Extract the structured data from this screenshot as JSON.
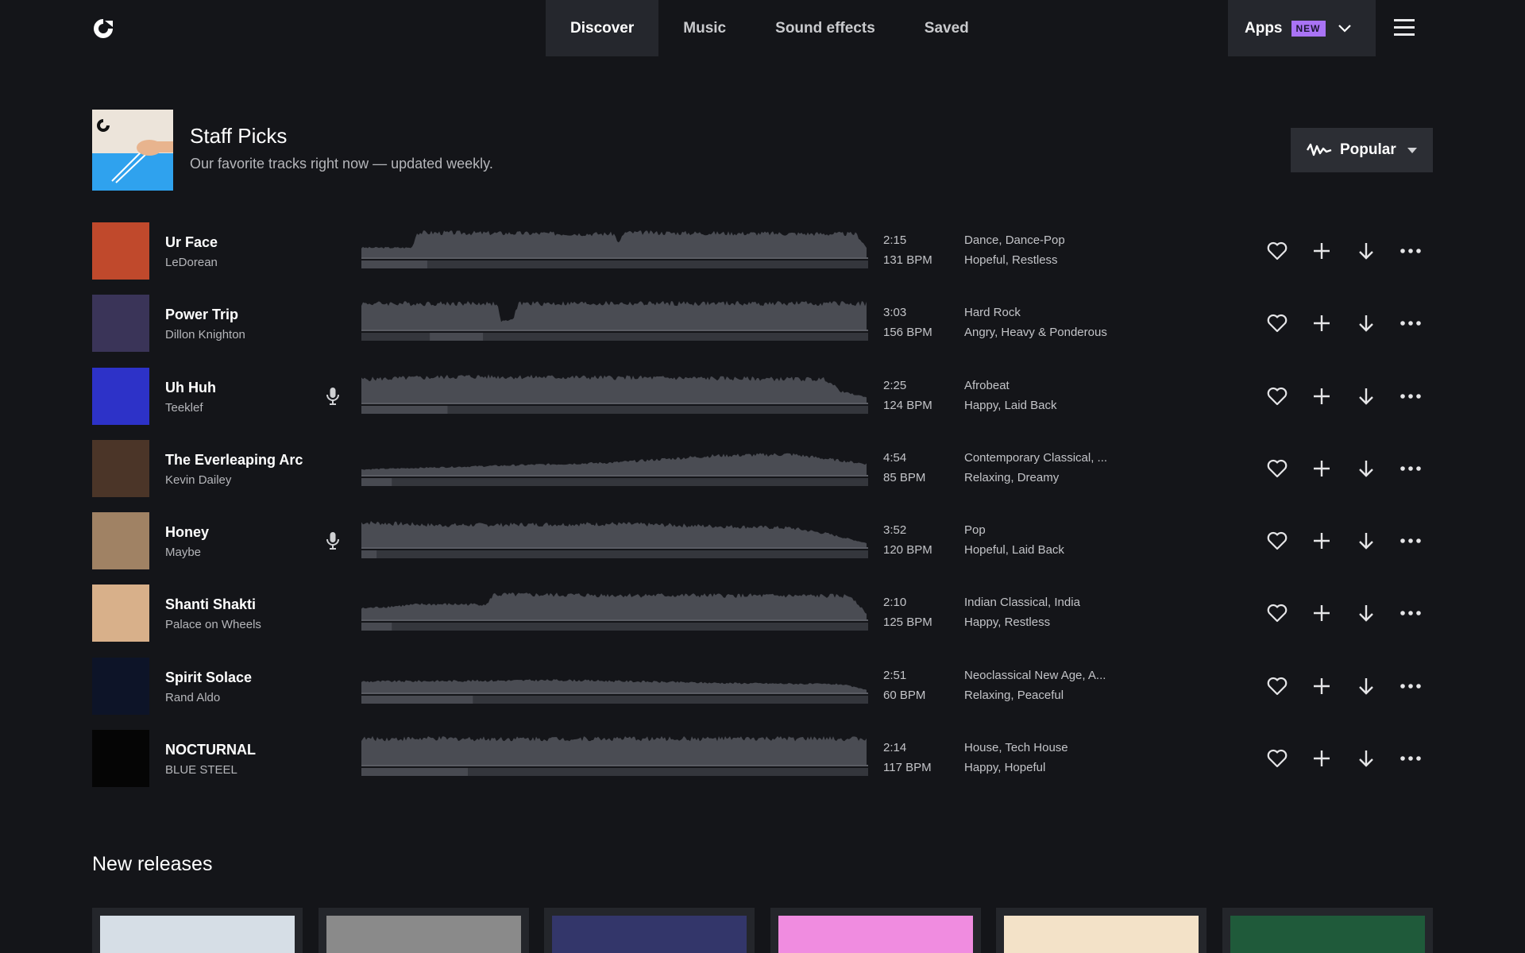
{
  "nav": {
    "tabs": [
      {
        "label": "Discover",
        "active": true
      },
      {
        "label": "Music",
        "active": false
      },
      {
        "label": "Sound effects",
        "active": false
      },
      {
        "label": "Saved",
        "active": false
      }
    ],
    "apps_label": "Apps",
    "apps_badge": "NEW",
    "icons": {
      "logo": "brand-logo-icon",
      "apps": "chevron-down-icon",
      "menu": "hamburger-menu-icon"
    }
  },
  "colors": {
    "background": "#141519",
    "nav_active": "#25272d",
    "badge": "#a973f5",
    "waveform": "#4a4c53"
  },
  "staff_picks": {
    "title": "Staff Picks",
    "subtitle": "Our favorite tracks right now — updated weekly.",
    "sort_label": "Popular",
    "sort_icon": "waveform-icon"
  },
  "tracks": [
    {
      "title": "Ur Face",
      "artist": "LeDorean",
      "duration": "2:15",
      "bpm": "131 BPM",
      "genres": "Dance, Dance-Pop",
      "moods": "Hopeful, Restless",
      "vocals": false,
      "art": "#c0492c"
    },
    {
      "title": "Power Trip",
      "artist": "Dillon Knighton",
      "duration": "3:03",
      "bpm": "156 BPM",
      "genres": "Hard Rock",
      "moods": "Angry, Heavy & Ponderous",
      "vocals": false,
      "art": "#3a3458"
    },
    {
      "title": "Uh Huh",
      "artist": "Teeklef",
      "duration": "2:25",
      "bpm": "124 BPM",
      "genres": "Afrobeat",
      "moods": "Happy, Laid Back",
      "vocals": true,
      "art": "#2d32c8"
    },
    {
      "title": "The Everleaping Arc",
      "artist": "Kevin Dailey",
      "duration": "4:54",
      "bpm": "85 BPM",
      "genres": "Contemporary Classical, ...",
      "moods": "Relaxing, Dreamy",
      "vocals": false,
      "art": "#4b3528"
    },
    {
      "title": "Honey",
      "artist": "Maybe",
      "duration": "3:52",
      "bpm": "120 BPM",
      "genres": "Pop",
      "moods": "Hopeful, Laid Back",
      "vocals": true,
      "art": "#a08264"
    },
    {
      "title": "Shanti Shakti",
      "artist": "Palace on Wheels",
      "duration": "2:10",
      "bpm": "125 BPM",
      "genres": "Indian Classical, India",
      "moods": "Happy, Restless",
      "vocals": false,
      "art": "#d8b08a"
    },
    {
      "title": "Spirit Solace",
      "artist": "Rand Aldo",
      "duration": "2:51",
      "bpm": "60 BPM",
      "genres": "Neoclassical New Age, A...",
      "moods": "Relaxing, Peaceful",
      "vocals": false,
      "art": "#0d1428"
    },
    {
      "title": "NOCTURNAL",
      "artist": "BLUE STEEL",
      "duration": "2:14",
      "bpm": "117 BPM",
      "genres": "House, Tech House",
      "moods": "Happy, Hopeful",
      "vocals": false,
      "art": "#050505"
    }
  ],
  "track_action_icons": [
    "heart-icon",
    "plus-icon",
    "download-icon",
    "more-icon"
  ],
  "new_releases": {
    "title": "New releases",
    "covers": [
      "#d6dee6",
      "#8a8a8a",
      "#33366a",
      "#f08ce0",
      "#f3e2c8",
      "#1f5a3a"
    ]
  }
}
